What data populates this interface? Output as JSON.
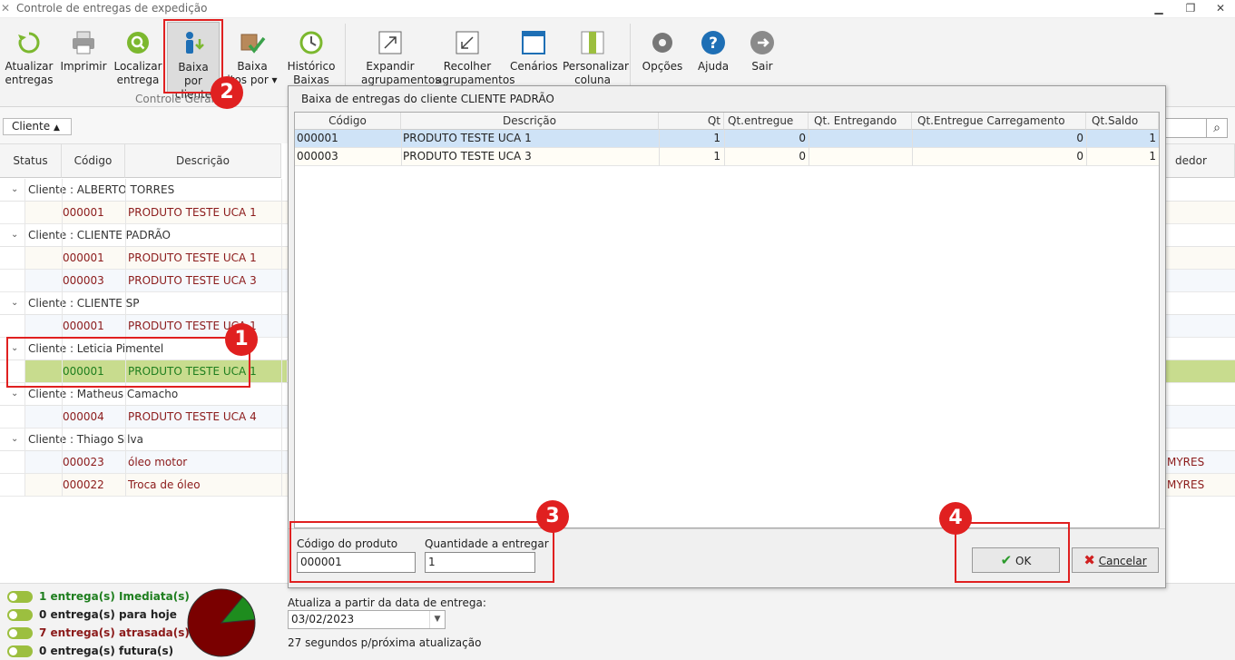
{
  "window": {
    "title": "Controle de entregas de expedição"
  },
  "ribbon": {
    "buttons": [
      {
        "l1": "Atualizar",
        "l2": "entregas"
      },
      {
        "l1": "Imprimir",
        "l2": ""
      },
      {
        "l1": "Localizar",
        "l2": "entrega"
      },
      {
        "l1": "Baixa por",
        "l2": "cliente"
      },
      {
        "l1": "Baixa",
        "l2": "itos por ▾"
      },
      {
        "l1": "Histórico",
        "l2": "Baixas"
      },
      {
        "l1": "Expandir",
        "l2": "agrupamentos"
      },
      {
        "l1": "Recolher",
        "l2": "agrupamentos"
      },
      {
        "l1": "Cenários",
        "l2": ""
      },
      {
        "l1": "Personalizar",
        "l2": "coluna"
      },
      {
        "l1": "Opções",
        "l2": ""
      },
      {
        "l1": "Ajuda",
        "l2": ""
      },
      {
        "l1": "Sair",
        "l2": ""
      }
    ],
    "group_label": "Controle Geral"
  },
  "groupbar": {
    "chip": "Cliente"
  },
  "grid": {
    "headers": [
      "Status",
      "Código",
      "Descrição"
    ],
    "header_right": "dedor",
    "rows": [
      {
        "type": "group",
        "text": "Cliente : ALBERTO TORRES"
      },
      {
        "type": "data",
        "code": "000001",
        "desc": "PRODUTO TESTE UCA 1",
        "extra": ""
      },
      {
        "type": "group",
        "text": "Cliente : CLIENTE PADRÃO"
      },
      {
        "type": "data",
        "code": "000001",
        "desc": "PRODUTO TESTE UCA 1",
        "extra": ""
      },
      {
        "type": "data",
        "code": "000003",
        "desc": "PRODUTO TESTE UCA 3",
        "extra": ""
      },
      {
        "type": "group",
        "text": "Cliente : CLIENTE SP"
      },
      {
        "type": "data",
        "code": "000001",
        "desc": "PRODUTO TESTE UCA 1",
        "extra": ""
      },
      {
        "type": "group",
        "text": "Cliente : Leticia Pimentel"
      },
      {
        "type": "data",
        "code": "000001",
        "desc": "PRODUTO TESTE UCA 1",
        "extra": ""
      },
      {
        "type": "group",
        "text": "Cliente : Matheus Camacho"
      },
      {
        "type": "data",
        "code": "000004",
        "desc": "PRODUTO TESTE UCA 4",
        "extra": ""
      },
      {
        "type": "group",
        "text": "Cliente : Thiago Silva"
      },
      {
        "type": "data",
        "code": "000023",
        "desc": "óleo motor",
        "extra": "MYRES"
      },
      {
        "type": "data",
        "code": "000022",
        "desc": "Troca de óleo",
        "extra": "MYRES"
      }
    ]
  },
  "status": {
    "legend": [
      {
        "text": "1 entrega(s) Imediata(s)",
        "color": "#1e7e1e"
      },
      {
        "text": "0 entrega(s) para hoje",
        "color": "#222222"
      },
      {
        "text": "7 entrega(s) atrasada(s)",
        "color": "#8b1a1a"
      },
      {
        "text": "0 entrega(s) futura(s)",
        "color": "#222222"
      }
    ],
    "pie": {
      "green_fraction": 0.125,
      "green": "#1e8c1e",
      "red": "#7a0000"
    },
    "date_label": "Atualiza a partir da data de entrega:",
    "date_value": "03/02/2023",
    "countdown": "27 segundos p/próxima atualização"
  },
  "dialog": {
    "title": "Baixa de entregas do cliente CLIENTE PADRÃO",
    "headers": [
      "Código",
      "Descrição",
      "Qt",
      "Qt.entregue",
      "Qt. Entregando",
      "Qt.Entregue Carregamento",
      "Qt.Saldo"
    ],
    "rows": [
      [
        "000001",
        "PRODUTO TESTE UCA 1",
        "1",
        "0",
        "",
        "0",
        "1"
      ],
      [
        "000003",
        "PRODUTO TESTE UCA 3",
        "1",
        "0",
        "",
        "0",
        "1"
      ]
    ],
    "code_label": "Código do produto",
    "code_value": "000001",
    "qty_label": "Quantidade a entregar",
    "qty_value": "1",
    "ok_label": "OK",
    "cancel_label": "Cancelar"
  },
  "annotations": [
    "1",
    "2",
    "3",
    "4"
  ],
  "colors": {
    "accent_red": "#e02020",
    "selected_row": "#c8dc8e",
    "dialog_selected": "#cfe3f7"
  }
}
